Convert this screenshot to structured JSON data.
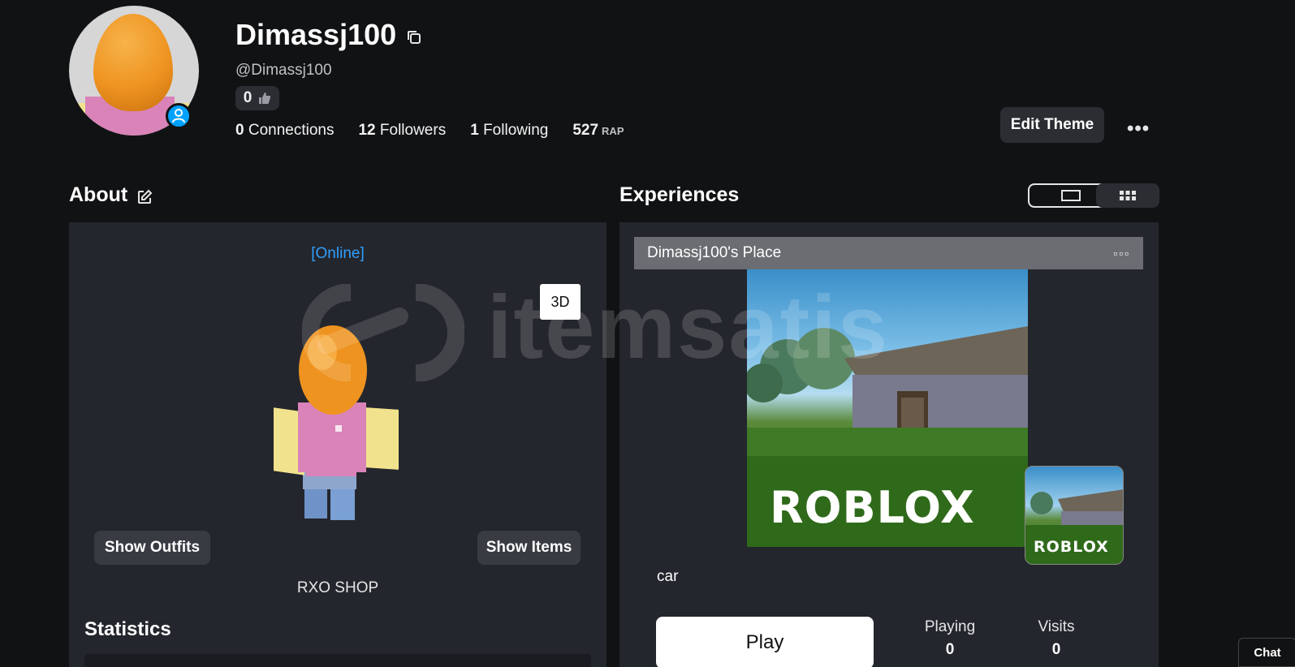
{
  "profile": {
    "display_name": "Dimassj100",
    "username": "@Dimassj100",
    "likes": "0",
    "connections_count": "0",
    "connections_label": "Connections",
    "followers_count": "12",
    "followers_label": "Followers",
    "following_count": "1",
    "following_label": "Following",
    "rap_value": "527",
    "rap_label": "RAP",
    "edit_theme_label": "Edit Theme",
    "more_label": "•••"
  },
  "about": {
    "title": "About",
    "status": "[Online]",
    "btn_3d": "3D",
    "show_outfits": "Show Outfits",
    "show_items": "Show Items",
    "description": "RXO SHOP",
    "statistics_title": "Statistics"
  },
  "experiences": {
    "title": "Experiences",
    "place_title": "Dimassj100's Place",
    "place_menu": "▫▫▫",
    "thumbnail_brand": "ROBLOX",
    "game_name": "car",
    "play_label": "Play",
    "playing_label": "Playing",
    "playing_value": "0",
    "visits_label": "Visits",
    "visits_value": "0"
  },
  "watermark": "itemsatis",
  "chat_label": "Chat",
  "colors": {
    "background": "#111214",
    "panel": "#24262d",
    "accent_online": "#2ea0ff",
    "presence": "#00a2ff"
  }
}
